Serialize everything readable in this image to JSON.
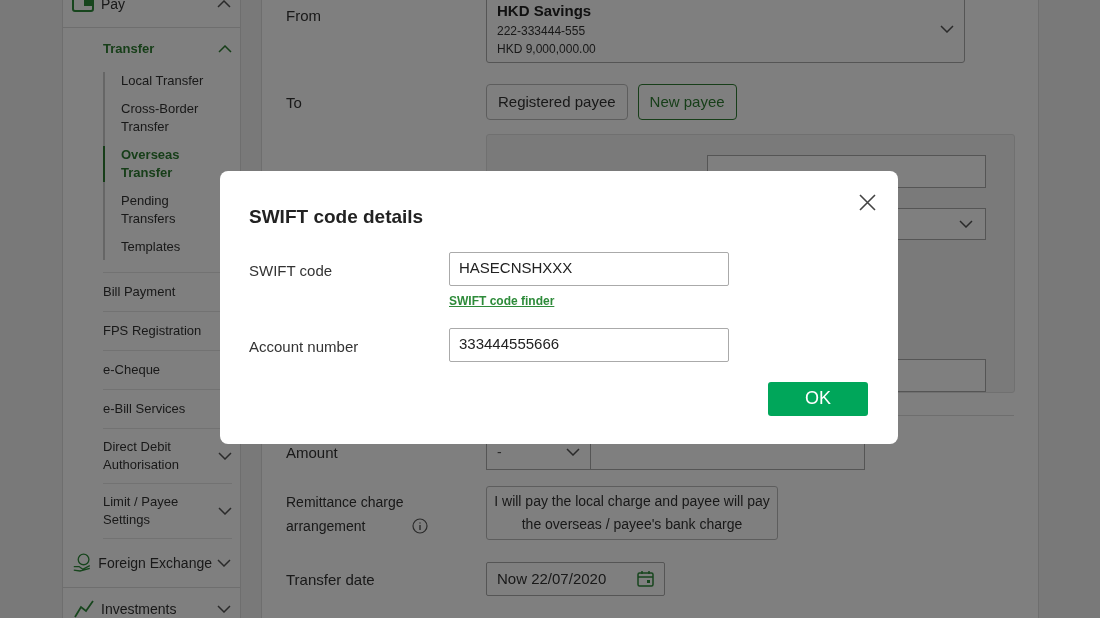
{
  "sidebar": {
    "items": [
      {
        "kind": "section",
        "label": "Pay",
        "expanded": true
      },
      {
        "kind": "group",
        "label": "Transfer",
        "expanded": true,
        "children": [
          {
            "label": "Local Transfer",
            "selected": false
          },
          {
            "label": "Cross-Border Transfer",
            "selected": false
          },
          {
            "label": "Overseas Transfer",
            "selected": true
          },
          {
            "label": "Pending Transfers",
            "selected": false
          },
          {
            "label": "Templates",
            "selected": false
          }
        ]
      },
      {
        "kind": "link",
        "label": "Bill Payment"
      },
      {
        "kind": "link",
        "label": "FPS Registration"
      },
      {
        "kind": "link",
        "label": "e-Cheque"
      },
      {
        "kind": "link",
        "label": "e-Bill Services"
      },
      {
        "kind": "group",
        "label": "Direct Debit Authorisation",
        "expanded": false
      },
      {
        "kind": "group",
        "label": "Limit / Payee Settings",
        "expanded": false
      },
      {
        "kind": "section",
        "label": "Foreign Exchange",
        "expanded": false
      },
      {
        "kind": "section",
        "label": "Investments",
        "expanded": false
      }
    ]
  },
  "form": {
    "from": {
      "label": "From",
      "account_name": "HKD Savings",
      "account_number": "222-333444-555",
      "balance": "HKD 9,000,000.00"
    },
    "to": {
      "label": "To",
      "options": [
        {
          "label": "Registered payee",
          "selected": false
        },
        {
          "label": "New payee",
          "selected": true
        }
      ]
    },
    "amount": {
      "label": "Amount",
      "currency": "-"
    },
    "remittance": {
      "label": "Remittance charge arrangement",
      "value": "I will pay the local charge and payee will pay the overseas / payee's bank charge"
    },
    "transfer_date": {
      "label": "Transfer date",
      "value": "Now 22/07/2020"
    }
  },
  "dialog": {
    "title": "SWIFT code details",
    "fields": [
      {
        "label": "SWIFT code",
        "value": "HASECNSHXXX",
        "link": "SWIFT code finder"
      },
      {
        "label": "Account number",
        "value": "333444555666"
      }
    ],
    "ok": "OK"
  }
}
